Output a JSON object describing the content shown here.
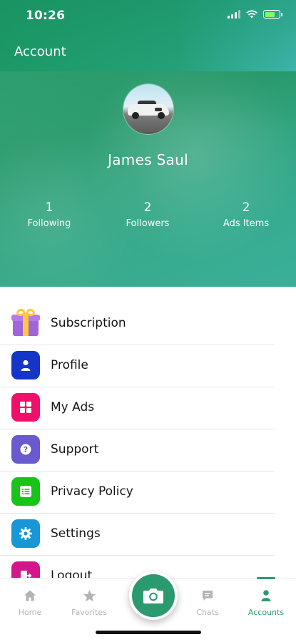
{
  "status_bar": {
    "time": "10:26"
  },
  "header": {
    "title": "Account",
    "user_name": "James Saul",
    "stats": [
      {
        "value": "1",
        "label": "Following"
      },
      {
        "value": "2",
        "label": "Followers"
      },
      {
        "value": "2",
        "label": "Ads Items"
      }
    ]
  },
  "menu": [
    {
      "label": "Subscription",
      "icon": "gift-icon"
    },
    {
      "label": "Profile",
      "icon": "person-icon"
    },
    {
      "label": "My Ads",
      "icon": "grid-icon"
    },
    {
      "label": "Support",
      "icon": "help-icon"
    },
    {
      "label": "Privacy Policy",
      "icon": "list-icon"
    },
    {
      "label": "Settings",
      "icon": "gear-icon"
    },
    {
      "label": "Logout",
      "icon": "logout-icon"
    }
  ],
  "bottom_nav": {
    "items": [
      {
        "label": "Home",
        "icon": "home-icon"
      },
      {
        "label": "Favorites",
        "icon": "star-icon"
      },
      {
        "label": "Chats",
        "icon": "chat-icon"
      },
      {
        "label": "Accounts",
        "icon": "person-icon"
      }
    ],
    "center_button_icon": "camera-icon",
    "active": "Accounts"
  },
  "colors": {
    "primary_green": "#2a9a6d",
    "profile": "#1534c8",
    "my_ads": "#f0106c",
    "support": "#6a5ad0",
    "privacy": "#17c417",
    "settings": "#1996d6",
    "logout": "#d4168a"
  }
}
